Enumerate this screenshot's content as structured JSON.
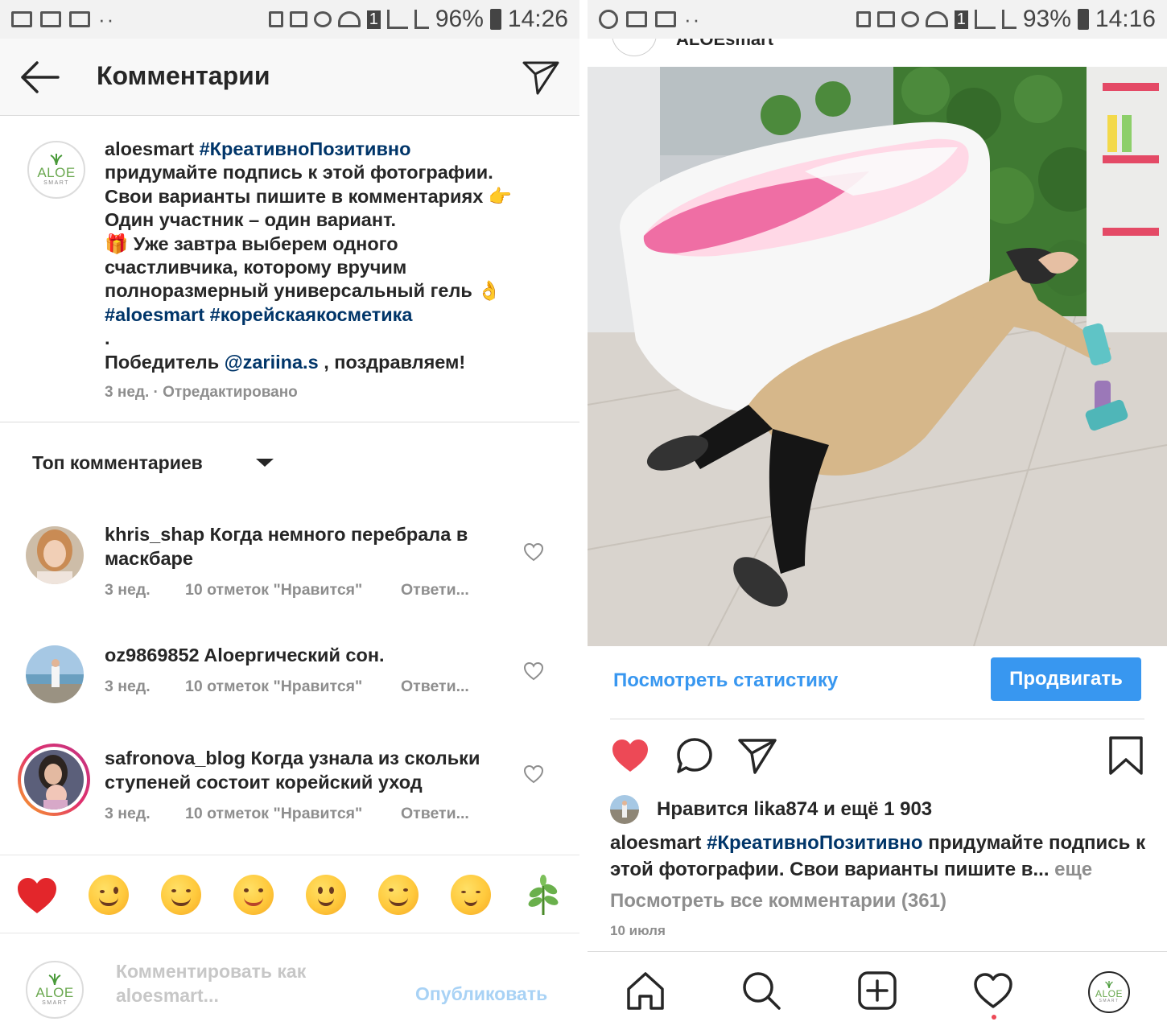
{
  "left": {
    "status": {
      "battery": "96%",
      "time": "14:26",
      "sim": "1"
    },
    "header": {
      "title": "Комментарии"
    },
    "caption": {
      "username": "aloesmart",
      "hashtag_1": "#КреативноПозитивно",
      "line_1": "придумайте подпись к этой фотографии.",
      "line_2": "Свои варианты пишите в комментариях 👉",
      "line_3": "Один участник – один вариант.",
      "line_4": "🎁 Уже завтра выберем одного",
      "line_5": "счастливчика, которому вручим",
      "line_6": "полноразмерный универсальный гель 👌",
      "hashtag_2": "#aloesmart",
      "hashtag_3": "#корейскаякосметика",
      "dot": ".",
      "winner_prefix": "Победитель",
      "winner_mention": "@zariina.s",
      "winner_suffix": ", поздравляем!",
      "meta": "3 нед. · Отредактировано"
    },
    "avatar_logo": {
      "word": "ALOE",
      "sub": "SMART"
    },
    "sort": {
      "label": "Топ комментариев"
    },
    "comments": [
      {
        "username": "khris_shap",
        "text": "Когда немного перебрала в маскбаре",
        "time": "3 нед.",
        "likes": "10 отметок \"Нравится\"",
        "reply": "Ответи..."
      },
      {
        "username": "oz9869852",
        "text": "Aloeргический сон.",
        "time": "3 нед.",
        "likes": "10 отметок \"Нравится\"",
        "reply": "Ответи..."
      },
      {
        "username": "safronova_blog",
        "text": "Когда узнала из скольки ступеней состоит корейский уход",
        "time": "3 нед.",
        "likes": "10 отметок \"Нравится\"",
        "reply": "Ответи..."
      }
    ],
    "emoji_bar": [
      "heart-emoji",
      "wink-emoji",
      "blush-emoji",
      "smiling-emoji",
      "slight-smile-emoji",
      "hug-emoji",
      "relieved-emoji",
      "seedling-emoji"
    ],
    "compose": {
      "placeholder": "Комментировать как aloesmart...",
      "publish": "Опубликовать"
    }
  },
  "right": {
    "status": {
      "battery": "93%",
      "time": "14:16",
      "sim": "1"
    },
    "header": {
      "username": "ALOEsmart"
    },
    "stats_link": "Посмотреть статистику",
    "promote": "Продвигать",
    "likes": {
      "prefix": "Нравится",
      "user": "lika874",
      "suffix": "и ещё 1 903"
    },
    "caption": {
      "username": "aloesmart",
      "hashtag": "#КреативноПозитивно",
      "text": "придумайте подпись к этой фотографии. Свои варианты пишите в...",
      "more": "еще"
    },
    "view_all": "Посмотреть все комментарии (361)",
    "date": "10 июля"
  },
  "colors": {
    "link": "#003569",
    "blue": "#3897f0",
    "muted": "#8e8e8e",
    "like_red": "#ed4956",
    "aloe_green": "#6aa84f"
  }
}
